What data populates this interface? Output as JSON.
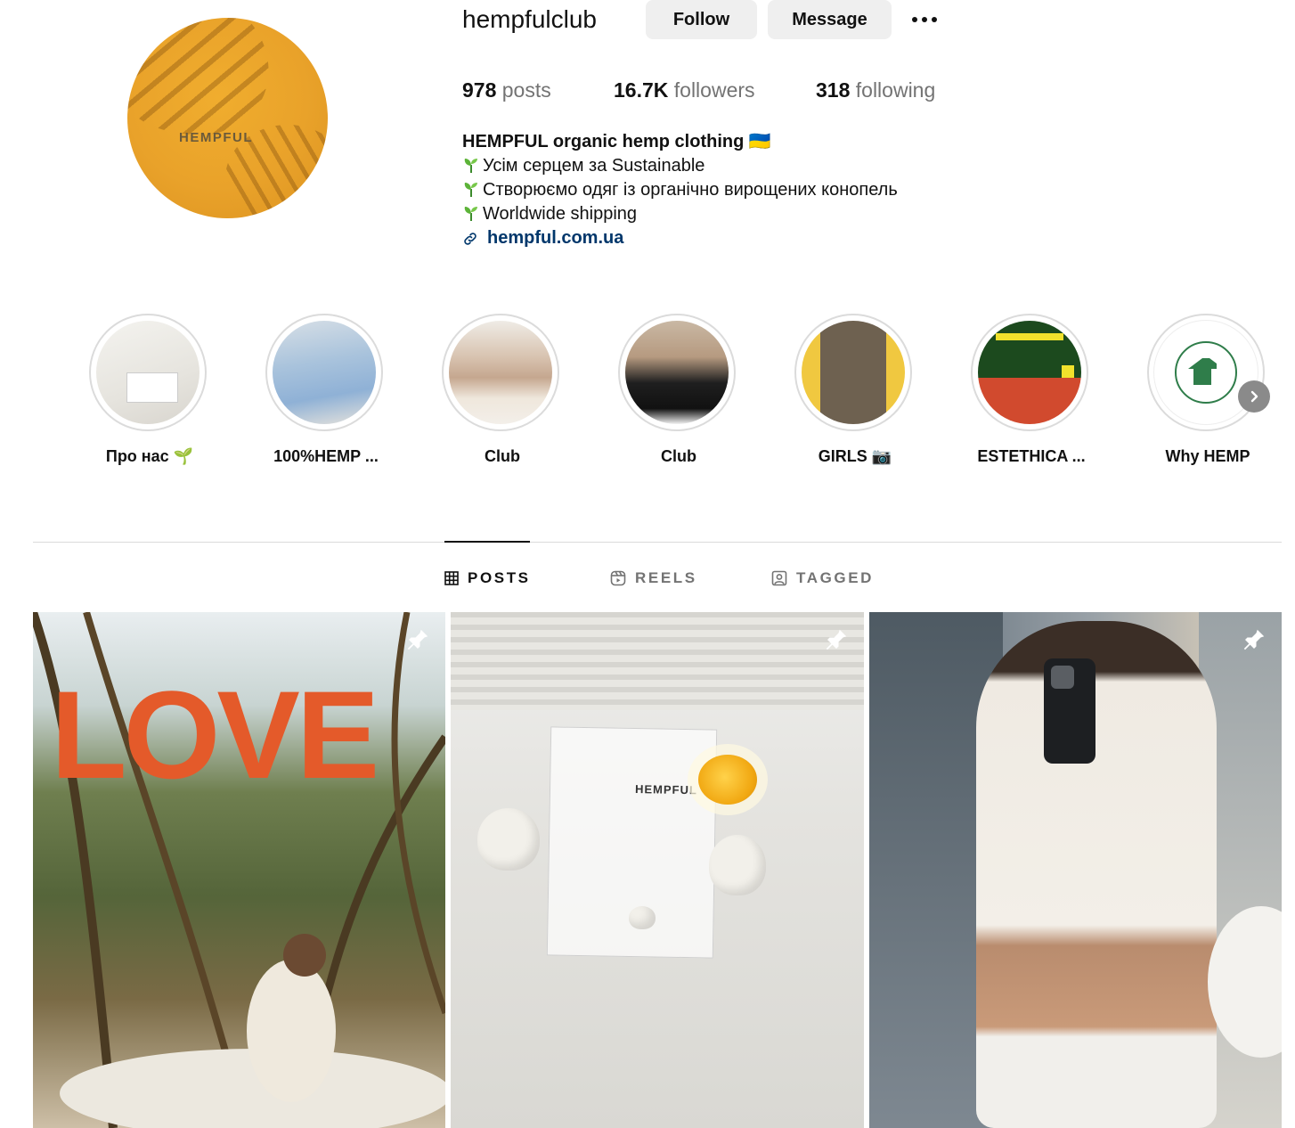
{
  "profile": {
    "username": "hempfulclub",
    "avatar_text": "HEMPFUL",
    "follow_label": "Follow",
    "message_label": "Message",
    "stats": {
      "posts_count": "978",
      "posts_label": "posts",
      "followers_count": "16.7K",
      "followers_label": "followers",
      "following_count": "318",
      "following_label": "following"
    },
    "bio": {
      "name": "HEMPFUL organic hemp clothing 🇺🇦",
      "lines": [
        "Усім серцем за Sustainable",
        "Створюємо одяг із органічно вирощених конопель",
        "Worldwide shipping"
      ],
      "link": "hempful.com.ua"
    }
  },
  "highlights": [
    {
      "label": "Про нас 🌱"
    },
    {
      "label": "100%HEMP ..."
    },
    {
      "label": "Club"
    },
    {
      "label": "Club"
    },
    {
      "label": "GIRLS 📷"
    },
    {
      "label": "ESTETHICA ..."
    },
    {
      "label": "Why HEMP"
    }
  ],
  "tabs": [
    {
      "label": "POSTS",
      "active": true
    },
    {
      "label": "REELS",
      "active": false
    },
    {
      "label": "TAGGED",
      "active": false
    }
  ],
  "posts": [
    {
      "overlay_text": "LOVE",
      "pinned": true
    },
    {
      "overlay_text": "HEMPFUL",
      "pinned": true
    },
    {
      "overlay_text": "",
      "pinned": true
    }
  ],
  "colors": {
    "link": "#00376b",
    "button_bg": "#efefef",
    "secondary_text": "#737373",
    "love_text": "#e45a2a",
    "avatar_bg": "#e9a22a"
  }
}
